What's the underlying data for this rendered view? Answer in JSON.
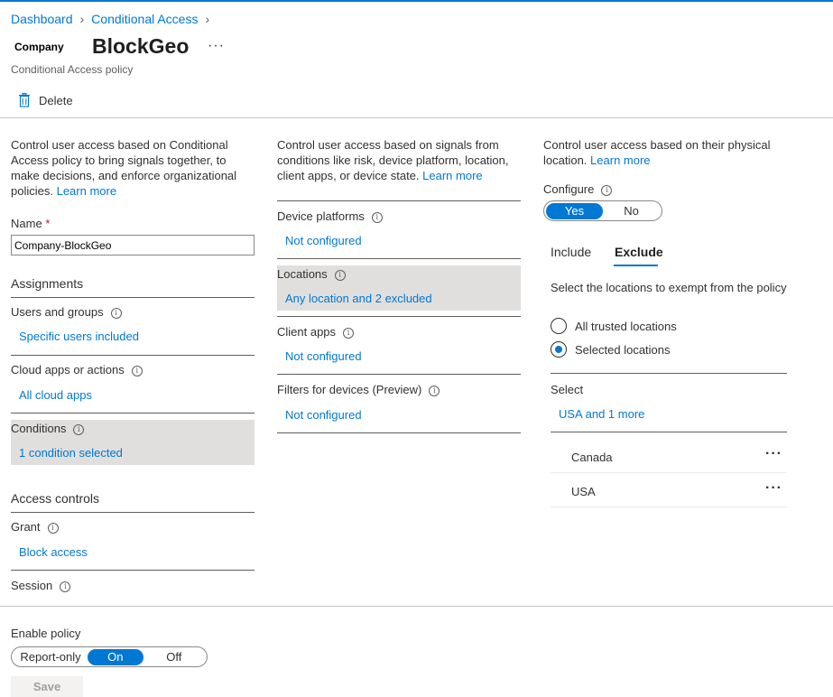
{
  "breadcrumb": {
    "items": [
      "Dashboard",
      "Conditional Access"
    ]
  },
  "header": {
    "company_label": "Company",
    "title": "BlockGeo",
    "more_label": "···",
    "subtitle": "Conditional Access policy"
  },
  "toolbar": {
    "delete_label": "Delete"
  },
  "col1": {
    "description": "Control user access based on Conditional Access policy to bring signals together, to make decisions, and enforce organizational policies.",
    "learn_more": "Learn more",
    "name_label": "Name",
    "name_required": "*",
    "name_value": "Company-BlockGeo",
    "assignments_heading": "Assignments",
    "users_label": "Users and groups",
    "users_value": "Specific users included",
    "cloud_label": "Cloud apps or actions",
    "cloud_value": "All cloud apps",
    "conditions_label": "Conditions",
    "conditions_value": "1 condition selected",
    "access_heading": "Access controls",
    "grant_label": "Grant",
    "grant_value": "Block access",
    "session_label": "Session"
  },
  "col2": {
    "description": "Control user access based on signals from conditions like risk, device platform, location, client apps, or device state.",
    "learn_more": "Learn more",
    "items": [
      {
        "label": "Device platforms",
        "value": "Not configured"
      },
      {
        "label": "Locations",
        "value": "Any location and 2 excluded"
      },
      {
        "label": "Client apps",
        "value": "Not configured"
      },
      {
        "label": "Filters for devices (Preview)",
        "value": "Not configured"
      }
    ]
  },
  "col3": {
    "description": "Control user access based on their physical location.",
    "learn_more": "Learn more",
    "configure_label": "Configure",
    "configure_yes": "Yes",
    "configure_no": "No",
    "configure_selected": "Yes",
    "tabs": [
      "Include",
      "Exclude"
    ],
    "active_tab": "Exclude",
    "exclude_description": "Select the locations to exempt from the policy",
    "radio_all_trusted": "All trusted locations",
    "radio_selected": "Selected locations",
    "radio_value": "Selected locations",
    "select_label": "Select",
    "select_value": "USA and 1 more",
    "locations": [
      "Canada",
      "USA"
    ],
    "row_more": "···"
  },
  "footer": {
    "enable_label": "Enable policy",
    "options": [
      "Report-only",
      "On",
      "Off"
    ],
    "selected": "On",
    "save_label": "Save"
  },
  "colors": {
    "accent": "#0078d4",
    "selected_bg": "#e1dfdd",
    "disabled_text": "#a19f9d"
  }
}
